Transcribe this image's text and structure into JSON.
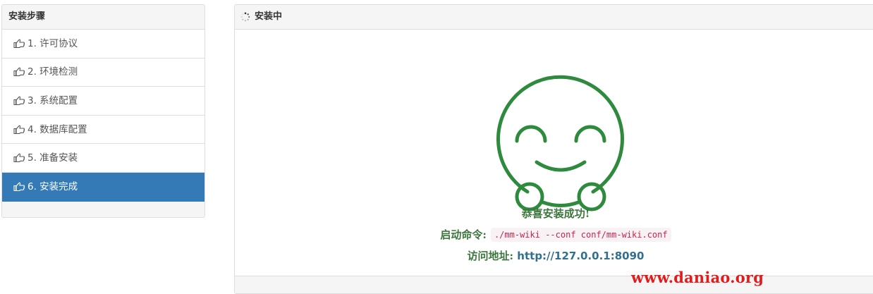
{
  "sidebar": {
    "title": "安装步骤",
    "items": [
      {
        "label": "1. 许可协议",
        "icon": "hand-point-right-icon",
        "active": false
      },
      {
        "label": "2. 环境检测",
        "icon": "hand-point-right-icon",
        "active": false
      },
      {
        "label": "3. 系统配置",
        "icon": "hand-point-right-icon",
        "active": false
      },
      {
        "label": "4. 数据库配置",
        "icon": "hand-point-right-icon",
        "active": false
      },
      {
        "label": "5. 准备安装",
        "icon": "hand-point-right-icon",
        "active": false
      },
      {
        "label": "6. 安装完成",
        "icon": "hand-point-right-icon",
        "active": true
      }
    ]
  },
  "main": {
    "title": "安装中",
    "title_icon": "spinner-icon",
    "illustration": "smiley-face-icon",
    "success_text": "恭喜安装成功!",
    "command_label": "启动命令:",
    "command_value": "./mm-wiki --conf conf/mm-wiki.conf",
    "url_label": "访问地址:",
    "url_value": "http://127.0.0.1:8090"
  },
  "watermark": "www.daniao.org",
  "colors": {
    "active_bg": "#337ab7",
    "success_green": "#3c763d",
    "smiley_green": "#2e8b3d",
    "code_red": "#c7254e",
    "link_blue": "#31708f",
    "watermark_red": "#e01c1c"
  }
}
